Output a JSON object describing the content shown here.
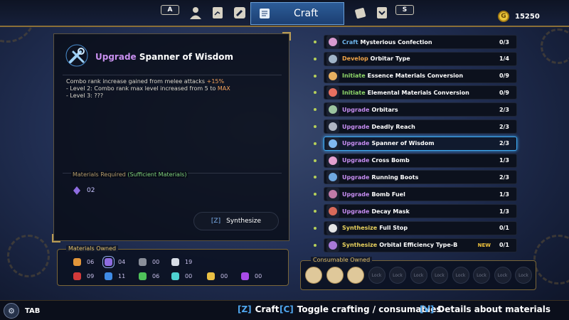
{
  "topbar": {
    "left_key": "A",
    "right_key": "S",
    "active_tab": "Craft",
    "tabs": [
      {
        "icon": "character-icon"
      },
      {
        "icon": "journal-icon"
      },
      {
        "icon": "wrench-icon"
      },
      {
        "icon": "craft-scroll-icon"
      },
      {
        "icon": "cards-icon"
      },
      {
        "icon": "rank-badge-icon"
      }
    ],
    "currency_symbol": "G",
    "currency_value": "15250"
  },
  "detail": {
    "verb": "Upgrade",
    "name": "Spanner of Wisdom",
    "icon": "spanner-icon",
    "description_line1": "Combo rank increase gained from melee attacks ",
    "description_line1_value": "+15%",
    "description_line2_prefix": "- Level 2: Combo rank max level increased from 5 to ",
    "description_line2_value": "MAX",
    "description_line3": "- Level 3: ???",
    "materials_required_label": "Materials Required",
    "materials_required_status": "(Sufficient Materials)",
    "materials_required": [
      {
        "icon": "purple-crystal-icon",
        "qty": "02",
        "color": "#8e6ce0"
      }
    ],
    "synthesize_key": "[Z]",
    "synthesize_label": "Synthesize"
  },
  "materials_owned": {
    "label": "Materials Owned",
    "items": [
      {
        "icon": "amber-shard-icon",
        "qty": "06",
        "color": "#e3963a"
      },
      {
        "icon": "purple-crystal-icon",
        "qty": "04",
        "color": "#8e6ce0",
        "selected": true
      },
      {
        "icon": "gray-ore-icon",
        "qty": "00",
        "color": "#8a8f9a"
      },
      {
        "icon": "white-orb-icon",
        "qty": "19",
        "color": "#d8dde6"
      },
      {
        "icon": "red-gem-icon",
        "qty": "09",
        "color": "#d33a3a"
      },
      {
        "icon": "blue-gem-icon",
        "qty": "11",
        "color": "#3f8be6"
      },
      {
        "icon": "green-gem-icon",
        "qty": "06",
        "color": "#4fc25a"
      },
      {
        "icon": "teal-crystal-icon",
        "qty": "00",
        "color": "#4ed1d1"
      },
      {
        "icon": "gold-nugget-icon",
        "qty": "00",
        "color": "#eac044"
      },
      {
        "icon": "violet-gem-icon",
        "qty": "00",
        "color": "#a84be8"
      }
    ]
  },
  "craft_list": [
    {
      "verb": "Craft",
      "verb_class": "v-craft",
      "name": "Mysterious Confection",
      "count": "0/3",
      "icon": "confection-icon",
      "icon_color": "#d89ad0"
    },
    {
      "verb": "Develop",
      "verb_class": "v-develop",
      "name": "Orbitar Type",
      "count": "1/4",
      "icon": "orbitar-robot-icon",
      "icon_color": "#a0b4c8"
    },
    {
      "verb": "Initiate",
      "verb_class": "v-initiate",
      "name": "Essence Materials Conversion",
      "count": "0/9",
      "icon": "conversion-icon",
      "icon_color": "#e8b060"
    },
    {
      "verb": "Initiate",
      "verb_class": "v-initiate",
      "name": "Elemental Materials Conversion",
      "count": "0/9",
      "icon": "conversion-icon",
      "icon_color": "#e87060"
    },
    {
      "verb": "Upgrade",
      "verb_class": "v-upgrade",
      "name": "Orbitars",
      "count": "2/3",
      "icon": "orbitar-icon",
      "icon_color": "#9cc4a0"
    },
    {
      "verb": "Upgrade",
      "verb_class": "v-upgrade",
      "name": "Deadly Reach",
      "count": "2/3",
      "icon": "gauntlet-icon",
      "icon_color": "#b0b6c2"
    },
    {
      "verb": "Upgrade",
      "verb_class": "v-upgrade",
      "name": "Spanner of Wisdom",
      "count": "2/3",
      "icon": "spanner-icon",
      "icon_color": "#7fb8f0",
      "selected": true
    },
    {
      "verb": "Upgrade",
      "verb_class": "v-upgrade",
      "name": "Cross Bomb",
      "count": "1/3",
      "icon": "cross-bomb-icon",
      "icon_color": "#e4a0d0"
    },
    {
      "verb": "Upgrade",
      "verb_class": "v-upgrade",
      "name": "Running Boots",
      "count": "2/3",
      "icon": "boots-icon",
      "icon_color": "#6fa8e0"
    },
    {
      "verb": "Upgrade",
      "verb_class": "v-upgrade",
      "name": "Bomb Fuel",
      "count": "1/3",
      "icon": "fuel-icon",
      "icon_color": "#c07aa8"
    },
    {
      "verb": "Upgrade",
      "verb_class": "v-upgrade",
      "name": "Decay Mask",
      "count": "1/3",
      "icon": "mask-icon",
      "icon_color": "#d86a5a"
    },
    {
      "verb": "Synthesize",
      "verb_class": "v-synth",
      "name": "Full Stop",
      "count": "0/1",
      "icon": "full-stop-icon",
      "icon_color": "#e6e6e6"
    },
    {
      "verb": "Synthesize",
      "verb_class": "v-synth",
      "name": "Orbital Efficiency Type-B",
      "count": "0/1",
      "icon": "orbital-chip-icon",
      "icon_color": "#a87ad8",
      "badge": "NEW"
    }
  ],
  "consumables": {
    "label": "Consumable Owned",
    "lock_label": "Lock",
    "items": [
      {
        "icon": "pastry-icon"
      },
      {
        "icon": "pastry-icon"
      },
      {
        "icon": "pizza-icon"
      }
    ]
  },
  "bottom": {
    "tab_label": "TAB",
    "hints": [
      {
        "key": "[Z]",
        "text": "Craft"
      },
      {
        "key": "[C]",
        "text": "Toggle crafting / consumables"
      },
      {
        "key": "[V]",
        "text": "Details about materials"
      }
    ]
  }
}
